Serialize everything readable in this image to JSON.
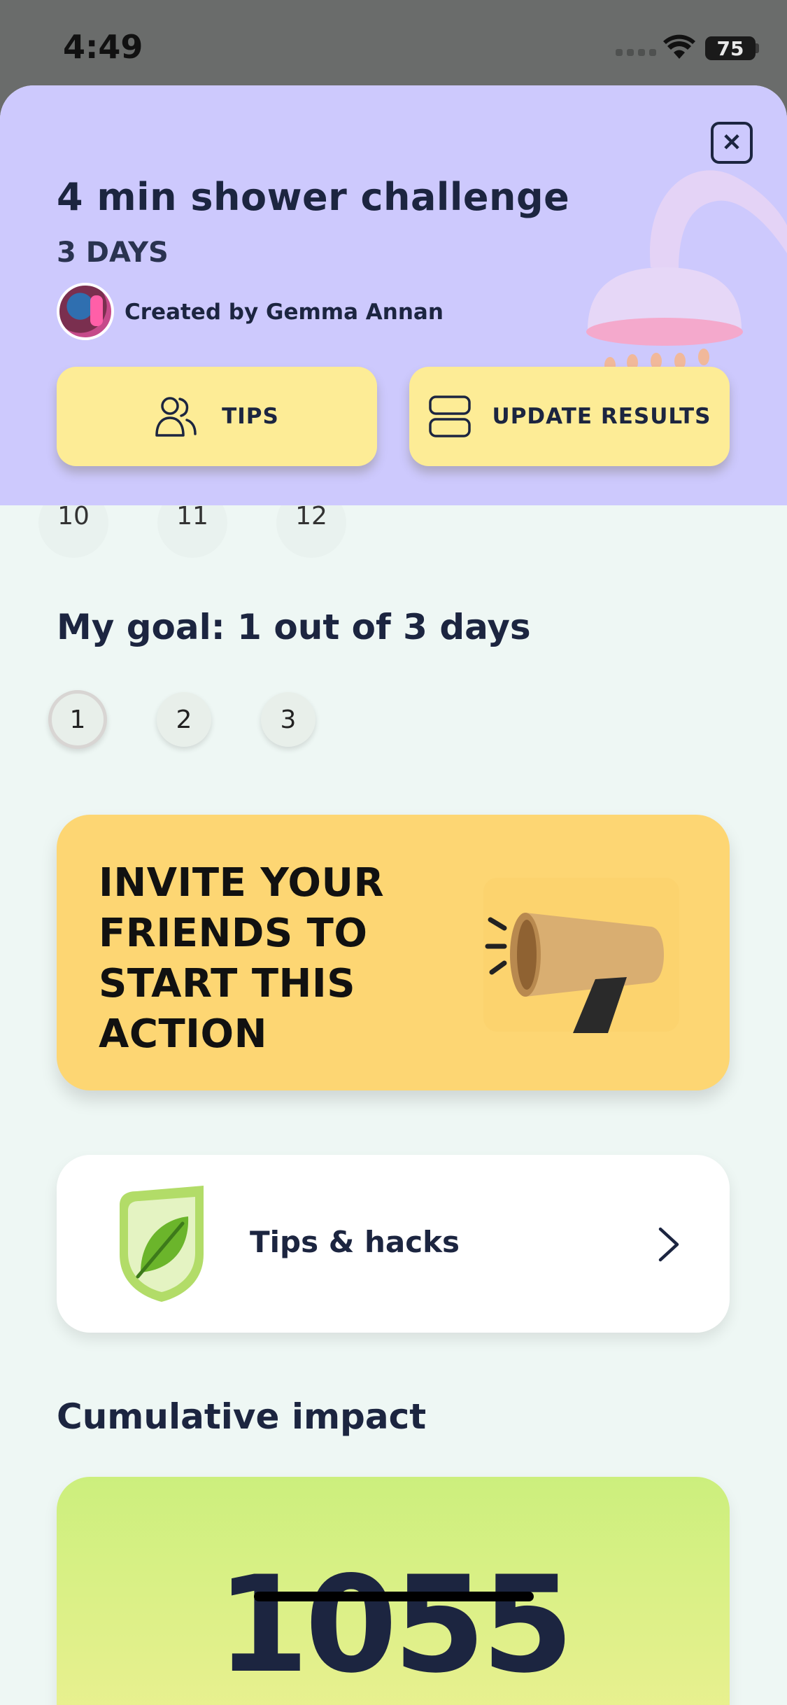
{
  "status_bar": {
    "time": "4:49",
    "battery": "75"
  },
  "header": {
    "close_symbol": "✕",
    "title": "4 min shower challenge",
    "duration": "3 DAYS",
    "creator_text": "Created by Gemma Annan",
    "tips_button": "TIPS",
    "update_button": "UPDATE RESULTS",
    "background": "#cdc9fd",
    "button_color": "#fdec96"
  },
  "calendar": {
    "days": [
      "10",
      "11",
      "12"
    ]
  },
  "goal": {
    "title": "My goal: 1 out of 3 days",
    "days": [
      "1",
      "2",
      "3"
    ]
  },
  "invite": {
    "text": "INVITE YOUR FRIENDS TO START THIS ACTION",
    "icon": "megaphone-icon",
    "color": "#fdd673"
  },
  "tips_hacks": {
    "label": "Tips & hacks",
    "icon": "leaf-shield-icon"
  },
  "impact": {
    "title": "Cumulative impact",
    "value": "1055"
  }
}
